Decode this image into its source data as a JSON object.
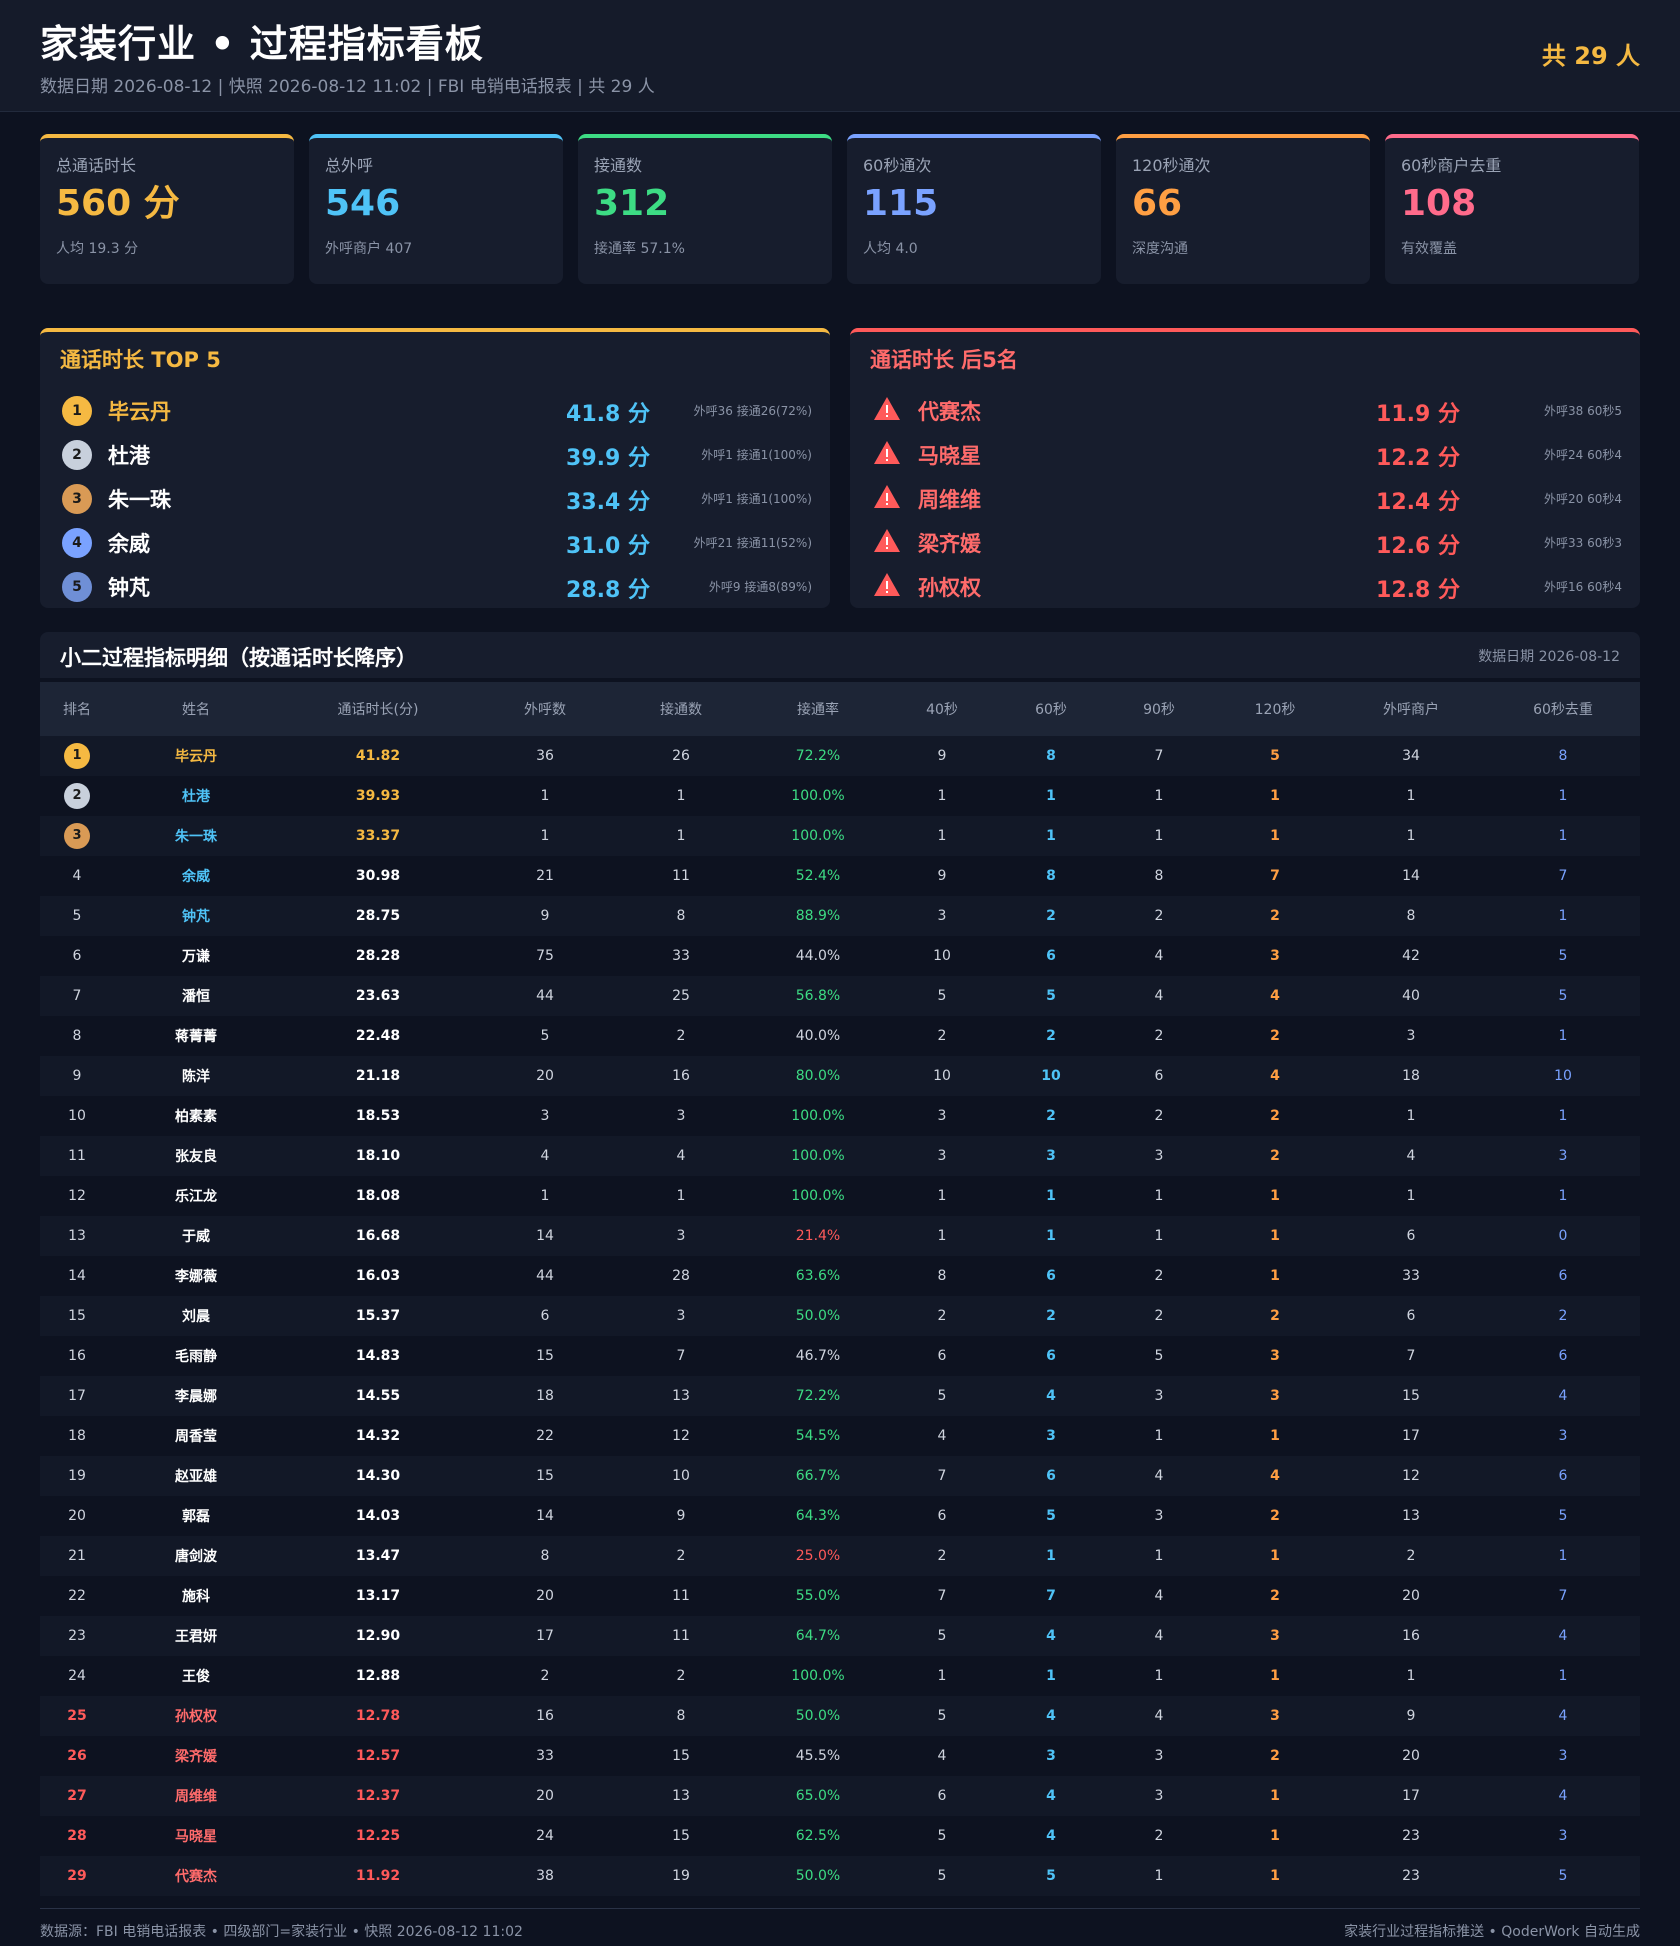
{
  "header": {
    "title": "家装行业 • 过程指标看板",
    "subtitle": "数据日期 2026-08-12 | 快照 2026-08-12 11:02 | FBI 电销电话报表 | 共 29 人",
    "total": "共 29 人"
  },
  "colors": {
    "gold": "#f5b942",
    "sky": "#4fc3f7",
    "green": "#3ddc84",
    "blue": "#7aa2ff",
    "orange": "#ff9f43",
    "pink": "#ff6b8b",
    "red": "#ff5a5a",
    "silver": "#c8d0dc",
    "bronze": "#d99a55"
  },
  "kpis": [
    {
      "label": "总通话时长",
      "value": "560 分",
      "sub": "人均 19.3 分",
      "color": "#f5b942"
    },
    {
      "label": "总外呼",
      "value": "546",
      "sub": "外呼商户 407",
      "color": "#4fc3f7"
    },
    {
      "label": "接通数",
      "value": "312",
      "sub": "接通率 57.1%",
      "color": "#3ddc84"
    },
    {
      "label": "60秒通次",
      "value": "115",
      "sub": "人均 4.0",
      "color": "#7aa2ff"
    },
    {
      "label": "120秒通次",
      "value": "66",
      "sub": "深度沟通",
      "color": "#ff9f43"
    },
    {
      "label": "60秒商户去重",
      "value": "108",
      "sub": "有效覆盖",
      "color": "#ff6b8b"
    }
  ],
  "top5": {
    "title": "通话时长 TOP 5",
    "items": [
      {
        "rank": "1",
        "name": "毕云丹",
        "value": "41.8 分",
        "sub": "外呼36 接通26(72%)",
        "medal": "#f5b942"
      },
      {
        "rank": "2",
        "name": "杜港",
        "value": "39.9 分",
        "sub": "外呼1 接通1(100%)",
        "medal": "#c8d0dc"
      },
      {
        "rank": "3",
        "name": "朱一珠",
        "value": "33.4 分",
        "sub": "外呼1 接通1(100%)",
        "medal": "#d99a55"
      },
      {
        "rank": "4",
        "name": "余威",
        "value": "31.0 分",
        "sub": "外呼21 接通11(52%)",
        "medal": "#7aa2ff"
      },
      {
        "rank": "5",
        "name": "钟芃",
        "value": "28.8 分",
        "sub": "外呼9 接通8(89%)",
        "medal": "#6f8fd6"
      }
    ]
  },
  "bottom5": {
    "title": "通话时长 后5名",
    "items": [
      {
        "name": "代赛杰",
        "value": "11.9 分",
        "sub": "外呼38 60秒5"
      },
      {
        "name": "马晓星",
        "value": "12.2 分",
        "sub": "外呼24 60秒4"
      },
      {
        "name": "周维维",
        "value": "12.4 分",
        "sub": "外呼20 60秒4"
      },
      {
        "name": "梁齐媛",
        "value": "12.6 分",
        "sub": "外呼33 60秒3"
      },
      {
        "name": "孙权权",
        "value": "12.8 分",
        "sub": "外呼16 60秒4"
      }
    ]
  },
  "detail": {
    "title": "小二过程指标明细（按通话时长降序）",
    "date": "数据日期 2026-08-12",
    "columns": [
      "排名",
      "姓名",
      "通话时长(分)",
      "外呼数",
      "接通数",
      "接通率",
      "40秒",
      "60秒",
      "90秒",
      "120秒",
      "外呼商户",
      "60秒去重"
    ],
    "rows": [
      [
        "1",
        "毕云丹",
        "41.82",
        "36",
        "26",
        "72.2%",
        "9",
        "8",
        "7",
        "5",
        "34",
        "8"
      ],
      [
        "2",
        "杜港",
        "39.93",
        "1",
        "1",
        "100.0%",
        "1",
        "1",
        "1",
        "1",
        "1",
        "1"
      ],
      [
        "3",
        "朱一珠",
        "33.37",
        "1",
        "1",
        "100.0%",
        "1",
        "1",
        "1",
        "1",
        "1",
        "1"
      ],
      [
        "4",
        "余威",
        "30.98",
        "21",
        "11",
        "52.4%",
        "9",
        "8",
        "8",
        "7",
        "14",
        "7"
      ],
      [
        "5",
        "钟芃",
        "28.75",
        "9",
        "8",
        "88.9%",
        "3",
        "2",
        "2",
        "2",
        "8",
        "1"
      ],
      [
        "6",
        "万谦",
        "28.28",
        "75",
        "33",
        "44.0%",
        "10",
        "6",
        "4",
        "3",
        "42",
        "5"
      ],
      [
        "7",
        "潘恒",
        "23.63",
        "44",
        "25",
        "56.8%",
        "5",
        "5",
        "4",
        "4",
        "40",
        "5"
      ],
      [
        "8",
        "蒋菁菁",
        "22.48",
        "5",
        "2",
        "40.0%",
        "2",
        "2",
        "2",
        "2",
        "3",
        "1"
      ],
      [
        "9",
        "陈洋",
        "21.18",
        "20",
        "16",
        "80.0%",
        "10",
        "10",
        "6",
        "4",
        "18",
        "10"
      ],
      [
        "10",
        "柏素素",
        "18.53",
        "3",
        "3",
        "100.0%",
        "3",
        "2",
        "2",
        "2",
        "1",
        "1"
      ],
      [
        "11",
        "张友良",
        "18.10",
        "4",
        "4",
        "100.0%",
        "3",
        "3",
        "3",
        "2",
        "4",
        "3"
      ],
      [
        "12",
        "乐江龙",
        "18.08",
        "1",
        "1",
        "100.0%",
        "1",
        "1",
        "1",
        "1",
        "1",
        "1"
      ],
      [
        "13",
        "于威",
        "16.68",
        "14",
        "3",
        "21.4%",
        "1",
        "1",
        "1",
        "1",
        "6",
        "0"
      ],
      [
        "14",
        "李娜薇",
        "16.03",
        "44",
        "28",
        "63.6%",
        "8",
        "6",
        "2",
        "1",
        "33",
        "6"
      ],
      [
        "15",
        "刘晨",
        "15.37",
        "6",
        "3",
        "50.0%",
        "2",
        "2",
        "2",
        "2",
        "6",
        "2"
      ],
      [
        "16",
        "毛雨静",
        "14.83",
        "15",
        "7",
        "46.7%",
        "6",
        "6",
        "5",
        "3",
        "7",
        "6"
      ],
      [
        "17",
        "李晨娜",
        "14.55",
        "18",
        "13",
        "72.2%",
        "5",
        "4",
        "3",
        "3",
        "15",
        "4"
      ],
      [
        "18",
        "周香莹",
        "14.32",
        "22",
        "12",
        "54.5%",
        "4",
        "3",
        "1",
        "1",
        "17",
        "3"
      ],
      [
        "19",
        "赵亚雄",
        "14.30",
        "15",
        "10",
        "66.7%",
        "7",
        "6",
        "4",
        "4",
        "12",
        "6"
      ],
      [
        "20",
        "郭磊",
        "14.03",
        "14",
        "9",
        "64.3%",
        "6",
        "5",
        "3",
        "2",
        "13",
        "5"
      ],
      [
        "21",
        "唐剑波",
        "13.47",
        "8",
        "2",
        "25.0%",
        "2",
        "1",
        "1",
        "1",
        "2",
        "1"
      ],
      [
        "22",
        "施科",
        "13.17",
        "20",
        "11",
        "55.0%",
        "7",
        "7",
        "4",
        "2",
        "20",
        "7"
      ],
      [
        "23",
        "王君妍",
        "12.90",
        "17",
        "11",
        "64.7%",
        "5",
        "4",
        "4",
        "3",
        "16",
        "4"
      ],
      [
        "24",
        "王俊",
        "12.88",
        "2",
        "2",
        "100.0%",
        "1",
        "1",
        "1",
        "1",
        "1",
        "1"
      ],
      [
        "25",
        "孙权权",
        "12.78",
        "16",
        "8",
        "50.0%",
        "5",
        "4",
        "4",
        "3",
        "9",
        "4"
      ],
      [
        "26",
        "梁齐媛",
        "12.57",
        "33",
        "15",
        "45.5%",
        "4",
        "3",
        "3",
        "2",
        "20",
        "3"
      ],
      [
        "27",
        "周维维",
        "12.37",
        "20",
        "13",
        "65.0%",
        "6",
        "4",
        "3",
        "1",
        "17",
        "4"
      ],
      [
        "28",
        "马晓星",
        "12.25",
        "24",
        "15",
        "62.5%",
        "5",
        "4",
        "2",
        "1",
        "23",
        "3"
      ],
      [
        "29",
        "代赛杰",
        "11.92",
        "38",
        "19",
        "50.0%",
        "5",
        "5",
        "1",
        "1",
        "23",
        "5"
      ]
    ]
  },
  "footer": {
    "left": "数据源：FBI 电销电话报表 • 四级部门=家装行业 • 快照 2026-08-12 11:02",
    "right": "家装行业过程指标推送 • QoderWork 自动生成"
  }
}
